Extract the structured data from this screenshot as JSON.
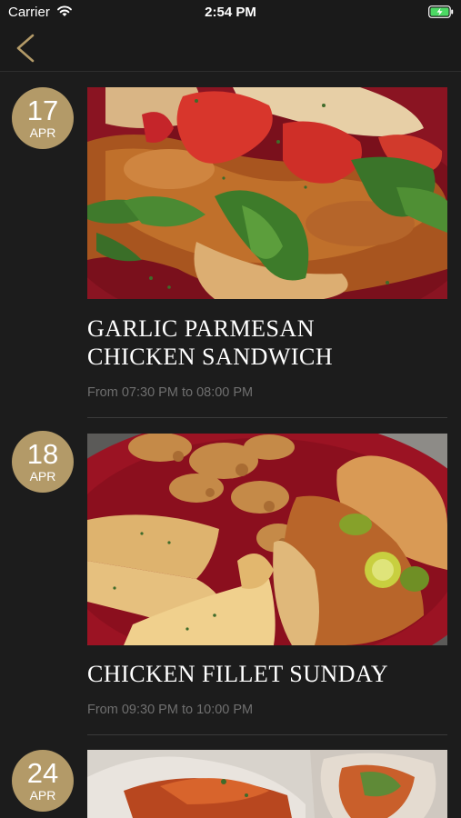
{
  "status_bar": {
    "carrier": "Carrier",
    "time": "2:54 PM",
    "wifi_icon": "wifi-icon",
    "battery_icon": "battery-charging-icon"
  },
  "nav": {
    "back_icon": "chevron-left-icon",
    "accent_color": "#b39a68"
  },
  "events": [
    {
      "day": "17",
      "month": "APR",
      "title_line1": "GARLIC PARMESAN",
      "title_line2": "CHICKEN SANDWICH",
      "time": "From 07:30 PM to 08:00 PM"
    },
    {
      "day": "18",
      "month": "APR",
      "title_line1": "CHICKEN FILLET SUNDAY",
      "title_line2": "",
      "time": "From 09:30 PM to 10:00 PM"
    },
    {
      "day": "24",
      "month": "APR",
      "title_line1": "",
      "title_line2": "",
      "time": ""
    }
  ],
  "colors": {
    "background": "#1c1c1c",
    "badge": "#b39a68",
    "subtext": "#6f6f6f"
  }
}
